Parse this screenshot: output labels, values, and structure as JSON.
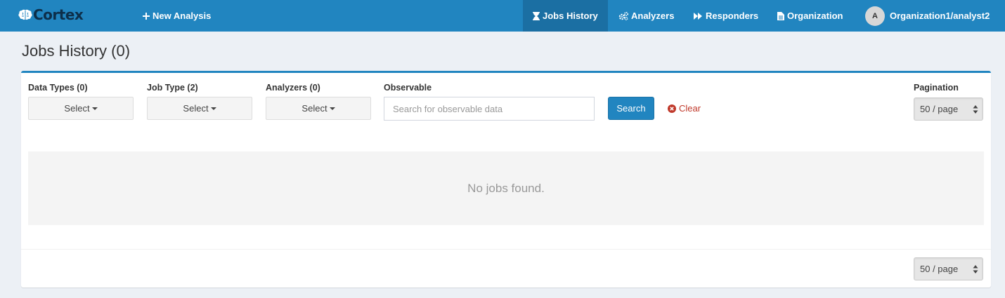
{
  "navbar": {
    "brand": "Cortex",
    "new_analysis": "New Analysis",
    "jobs_history": "Jobs History",
    "analyzers": "Analyzers",
    "responders": "Responders",
    "organization": "Organization",
    "avatar_letter": "A",
    "user": "Organization1/analyst2",
    "color": "#2185c0",
    "active_color": "#1b6fa3"
  },
  "page": {
    "title": "Jobs History (0)"
  },
  "filters": {
    "data_types": {
      "label": "Data Types (0)",
      "button": "Select"
    },
    "job_type": {
      "label": "Job Type (2)",
      "button": "Select"
    },
    "analyzers": {
      "label": "Analyzers (0)",
      "button": "Select"
    },
    "observable": {
      "label": "Observable",
      "placeholder": "Search for observable data",
      "value": ""
    },
    "search_button": "Search",
    "clear_link": "Clear",
    "pagination": {
      "label": "Pagination",
      "value": "50 / page"
    }
  },
  "results": {
    "empty_message": "No jobs found."
  },
  "footer": {
    "pagination_value": "50 / page"
  }
}
